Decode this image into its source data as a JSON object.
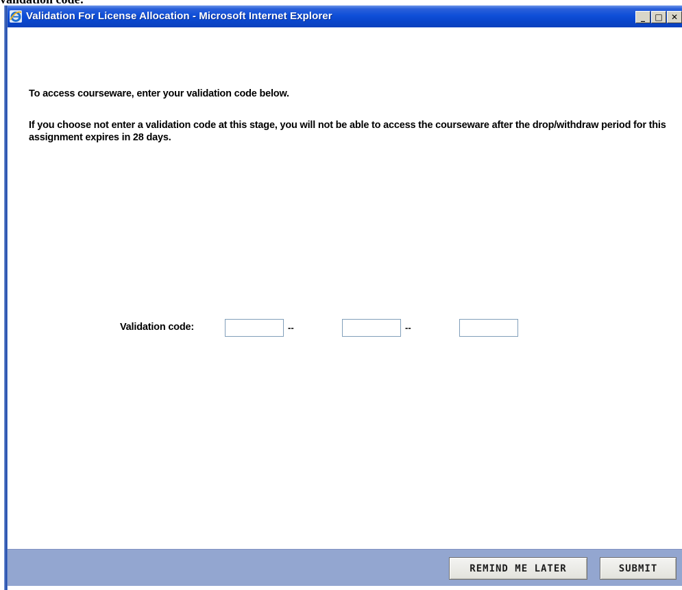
{
  "page": {
    "caption": "validation code:"
  },
  "window": {
    "title": "Validation For License Allocation - Microsoft Internet Explorer",
    "controls": {
      "minimize": "_",
      "maximize": "□",
      "close": "✕"
    }
  },
  "content": {
    "message_1": "To access courseware, enter your validation code below.",
    "message_2": "If you choose not enter a validation code at this stage, you will not be able to access the courseware after the drop/withdraw period for this assignment expires in 28 days.",
    "validation": {
      "label": "Validation code:",
      "separator": "--",
      "fields": [
        {
          "value": "",
          "placeholder": ""
        },
        {
          "value": "",
          "placeholder": ""
        },
        {
          "value": "",
          "placeholder": ""
        }
      ]
    }
  },
  "footer": {
    "remind_label": "REMIND ME LATER",
    "submit_label": "SUBMIT"
  },
  "colors": {
    "titlebar": "#0f4fd8",
    "footer": "#93a6d0",
    "input_border": "#7f9db9"
  },
  "icons": {
    "app_icon": "internet-explorer-icon"
  }
}
